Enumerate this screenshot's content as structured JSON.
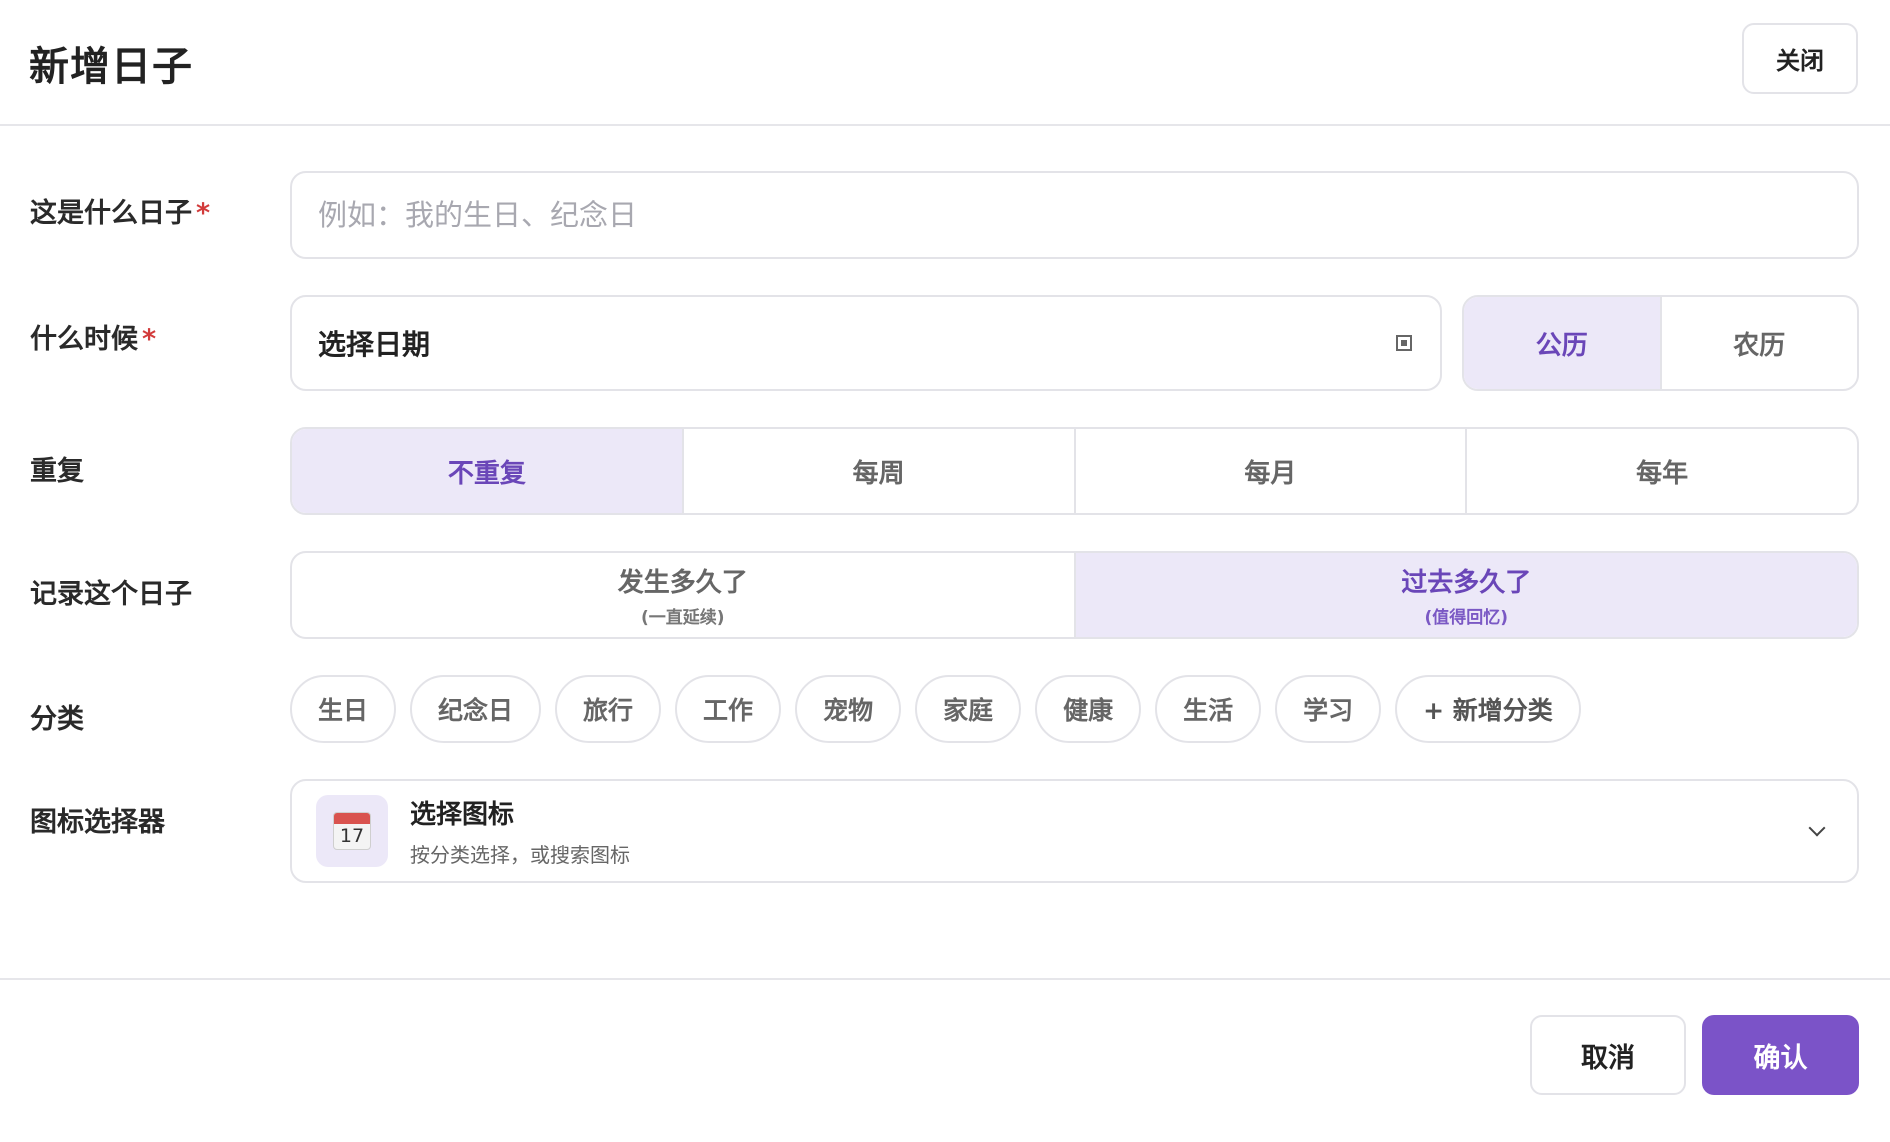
{
  "dialog": {
    "title": "新增日子",
    "close_label": "关闭"
  },
  "form": {
    "name": {
      "label": "这是什么日子",
      "required_mark": "*",
      "placeholder": "例如：我的生日、纪念日",
      "value": ""
    },
    "date": {
      "label": "什么时候",
      "required_mark": "*",
      "value": "选择日期",
      "icon": "calendar-icon",
      "calendar_types": [
        {
          "label": "公历",
          "selected": true
        },
        {
          "label": "农历",
          "selected": false
        }
      ]
    },
    "repeat": {
      "label": "重复",
      "options": [
        {
          "label": "不重复",
          "selected": true
        },
        {
          "label": "每周",
          "selected": false
        },
        {
          "label": "每月",
          "selected": false
        },
        {
          "label": "每年",
          "selected": false
        }
      ]
    },
    "record": {
      "label": "记录这个日子",
      "options": [
        {
          "label": "发生多久了",
          "sub": "(一直延续)",
          "selected": false
        },
        {
          "label": "过去多久了",
          "sub": "(值得回忆)",
          "selected": true
        }
      ]
    },
    "category": {
      "label": "分类",
      "chips": [
        "生日",
        "纪念日",
        "旅行",
        "工作",
        "宠物",
        "家庭",
        "健康",
        "生活",
        "学习"
      ],
      "add_label": "+ 新增分类"
    },
    "icon_picker": {
      "label": "图标选择器",
      "title": "选择图标",
      "subtitle": "按分类选择，或搜索图标",
      "icon": "calendar-17-icon",
      "icon_day": "17"
    }
  },
  "footer": {
    "cancel_label": "取消",
    "confirm_label": "确认"
  },
  "colors": {
    "accent": "#7b53c8",
    "selected_bg": "#ece8f8",
    "selected_text": "#6a46b8",
    "required": "#d23b3b",
    "border": "#e3e3e8"
  }
}
